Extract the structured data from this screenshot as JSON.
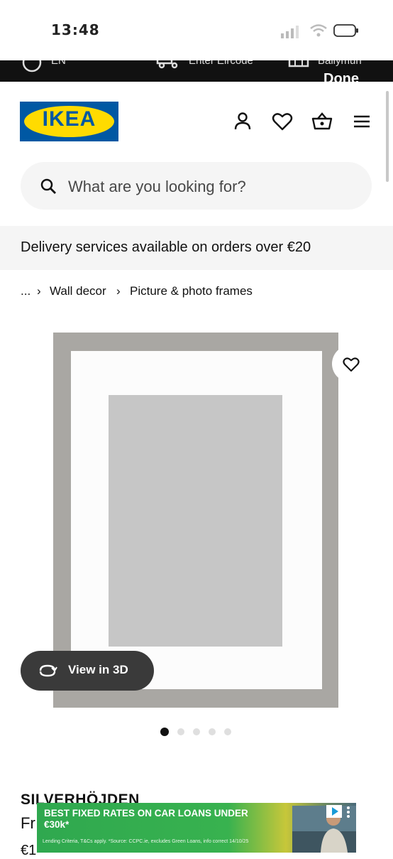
{
  "status_bar": {
    "time": "13:48"
  },
  "top_strip": {
    "items": [
      "EN",
      "Enter Eircode",
      "Ballymun"
    ],
    "done": "Done"
  },
  "header": {
    "logo_text": "IKEA"
  },
  "search": {
    "placeholder": "What are you looking for?"
  },
  "delivery_banner": {
    "text": "Delivery services available on orders over €20"
  },
  "breadcrumb": {
    "ellipsis": "...",
    "items": [
      "Wall decor",
      "Picture & photo frames"
    ]
  },
  "product_image": {
    "view_3d_label": "View in 3D",
    "carousel_dots": 5,
    "active_dot": 0
  },
  "product": {
    "name": "SILVERHÖJDEN",
    "subtitle": "Fr",
    "price": "€1"
  },
  "ad": {
    "headline": "BEST FIXED RATES ON CAR LOANS UNDER €30k*",
    "fine_print": "Lending Criteria, T&Cs apply. *Source: CCPC.ie, excludes Green Loans, info correct 14/10/25"
  },
  "colors": {
    "ikea_blue": "#0058a3",
    "ikea_yellow": "#ffdb00",
    "ad_green": "#38b24f"
  }
}
